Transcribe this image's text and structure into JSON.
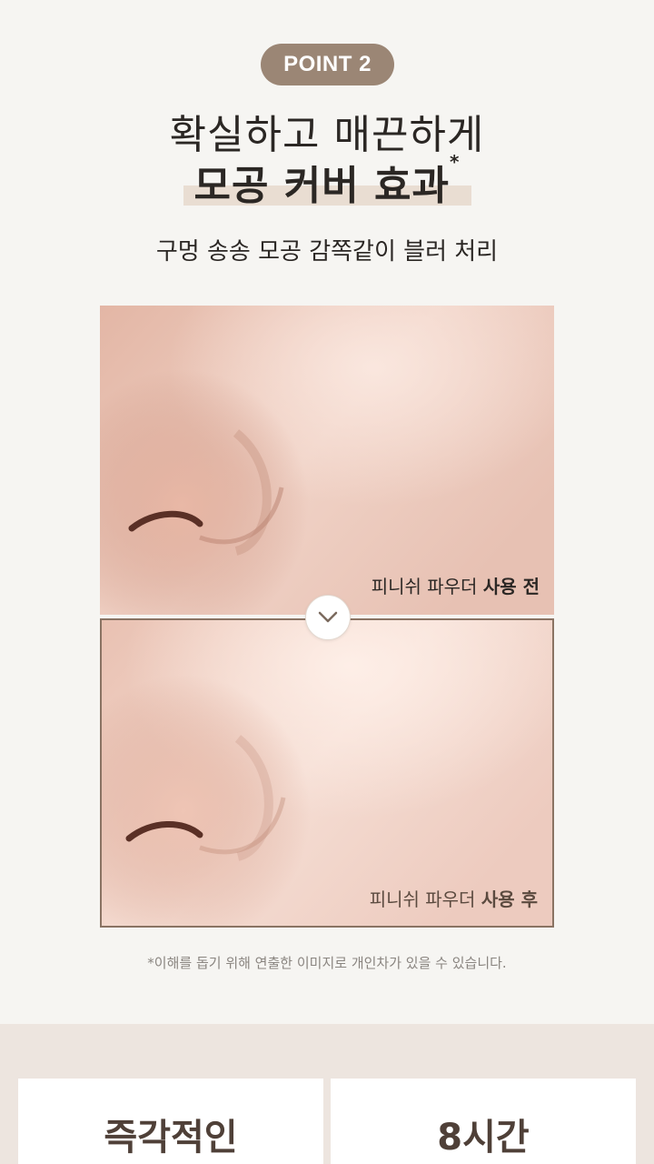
{
  "badge": "POINT 2",
  "headline": {
    "line1": "확실하고 매끈하게",
    "line2": "모공 커버 효과",
    "footnote_mark": "*"
  },
  "subtitle": "구멍 송송 모공 감쪽같이 블러 처리",
  "comparison": {
    "before": {
      "label_prefix": "피니쉬 파우더 ",
      "label_strong": "사용 전"
    },
    "after": {
      "label_prefix": "피니쉬 파우더 ",
      "label_strong": "사용 후"
    },
    "arrow_icon": "chevron-down-icon"
  },
  "disclaimer": "*이해를 돕기 위해 연출한 이미지로 개인차가 있을 수 있습니다.",
  "cards": [
    {
      "title": "즉각적인"
    },
    {
      "title": "8시간"
    }
  ],
  "colors": {
    "badge": "#9b8675",
    "highlight": "#e9ddd2",
    "frame": "#8a7363",
    "background": "#f6f5f2",
    "bottom_band": "#ede5df"
  }
}
